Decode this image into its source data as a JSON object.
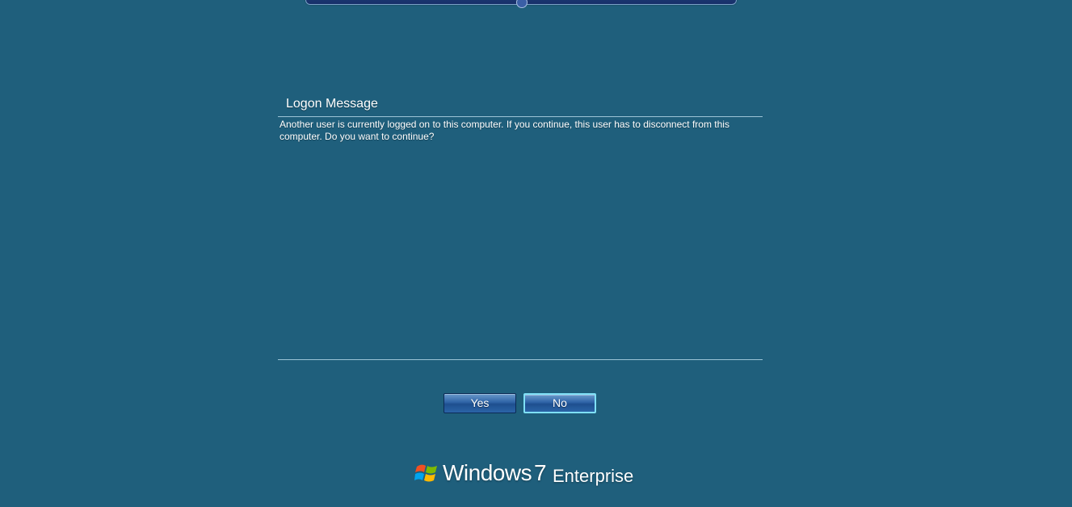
{
  "dialog": {
    "title": "Logon Message",
    "message": "Another user is currently logged on to this computer. If you continue, this user has to disconnect from this computer. Do you want to continue?"
  },
  "buttons": {
    "yes": "Yes",
    "no": "No"
  },
  "branding": {
    "product": "Windows",
    "version": "7",
    "edition": "Enterprise",
    "logo_icon": "windows-flag-icon"
  },
  "colors": {
    "background": "#1f5f7c",
    "rule": "#9cc4d6",
    "button_focus_border": "#7fe0f6"
  }
}
